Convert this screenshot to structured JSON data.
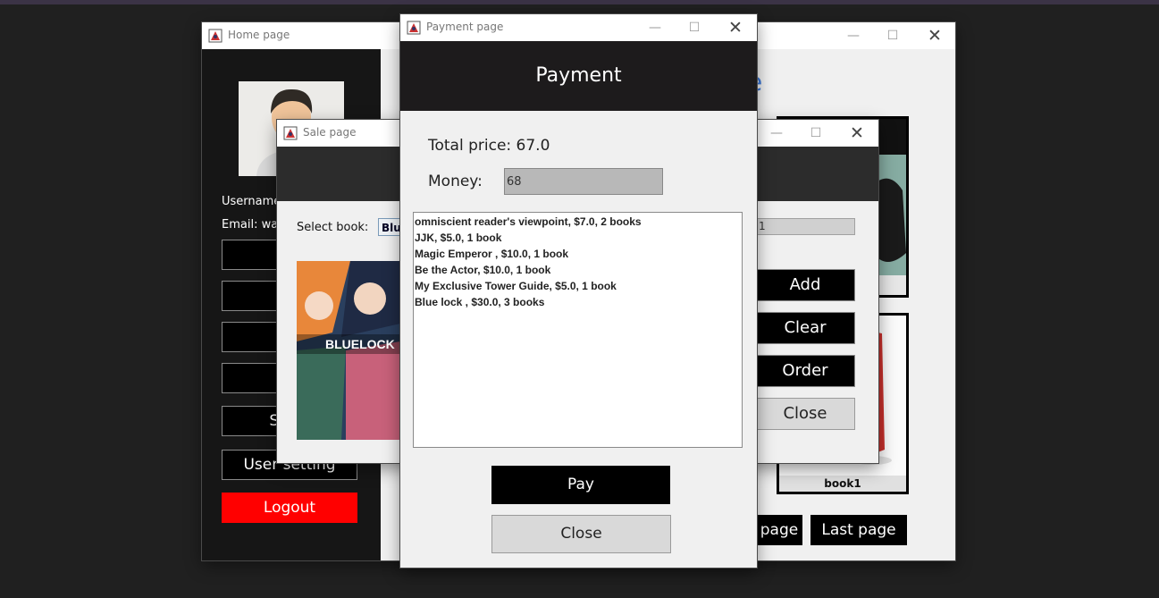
{
  "home": {
    "window_title": "Home page",
    "username_label": "Username",
    "email_label": "Email: wari",
    "nav_buttons": [
      "A",
      "",
      "D",
      "S",
      "Sales",
      "User setting"
    ],
    "logout": "Logout",
    "title_fragment": "e",
    "book_caption": "book1",
    "prev_page": "page",
    "last_page": "Last page"
  },
  "sale": {
    "window_title": "Sale page",
    "select_label": "Select book:",
    "select_value": "Blue",
    "quantity_value": "1",
    "cover_text": "BLUELOCK",
    "buttons": {
      "add": "Add",
      "clear": "Clear",
      "order": "Order",
      "close": "Close"
    }
  },
  "payment": {
    "window_title": "Payment page",
    "heading": "Payment",
    "total_label": "Total price: 67.0",
    "money_label": "Money:",
    "money_value": "68",
    "orders": [
      "omniscient reader's viewpoint, $7.0, 2 books",
      "JJK, $5.0, 1 book",
      "Magic Emperor , $10.0, 1 book",
      "Be the Actor, $10.0, 1 book",
      "My Exclusive Tower Guide, $5.0, 1 book",
      "Blue lock , $30.0, 3 books"
    ],
    "pay_button": "Pay",
    "close_button": "Close"
  },
  "window_controls": {
    "minimize": "—",
    "maximize": "☐",
    "close": "✕"
  },
  "colors": {
    "logout": "#ff0000",
    "sidebar": "#161616",
    "header": "#1d1b1c"
  }
}
